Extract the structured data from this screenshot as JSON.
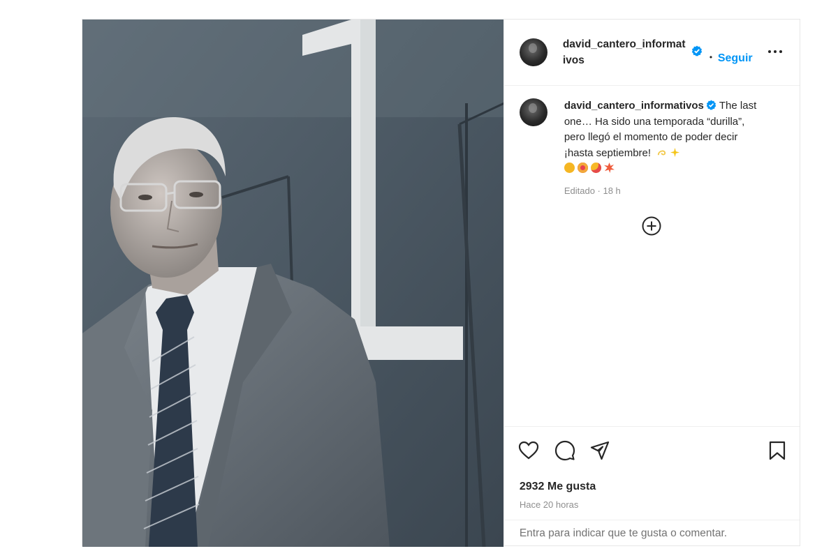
{
  "post": {
    "username": "david_cantero_informativos",
    "follow_label": "Seguir",
    "dot": "•",
    "caption": {
      "username": "david_cantero_informativos",
      "text": "The last one… Ha sido una temporada “durilla”, pero llegó el momento de poder decir ¡hasta septiembre!",
      "emojis": [
        "dizzy",
        "sparkles",
        "grin",
        "heart-eyes",
        "zany-face",
        "collision"
      ],
      "edited": "Editado",
      "time": "18 h"
    },
    "likes": "2932 Me gusta",
    "ago": "Hace 20 horas",
    "comment_placeholder": "Entra para indicar que te gusta o comentar."
  },
  "icons": {
    "verified": "verified-badge-icon",
    "more": "more-options-icon",
    "add": "add-comment-icon",
    "like": "heart-icon",
    "comment": "comment-icon",
    "share": "share-icon",
    "save": "bookmark-icon"
  },
  "colors": {
    "accent": "#0095f6",
    "text": "#262626",
    "muted": "#8e8e8e"
  }
}
